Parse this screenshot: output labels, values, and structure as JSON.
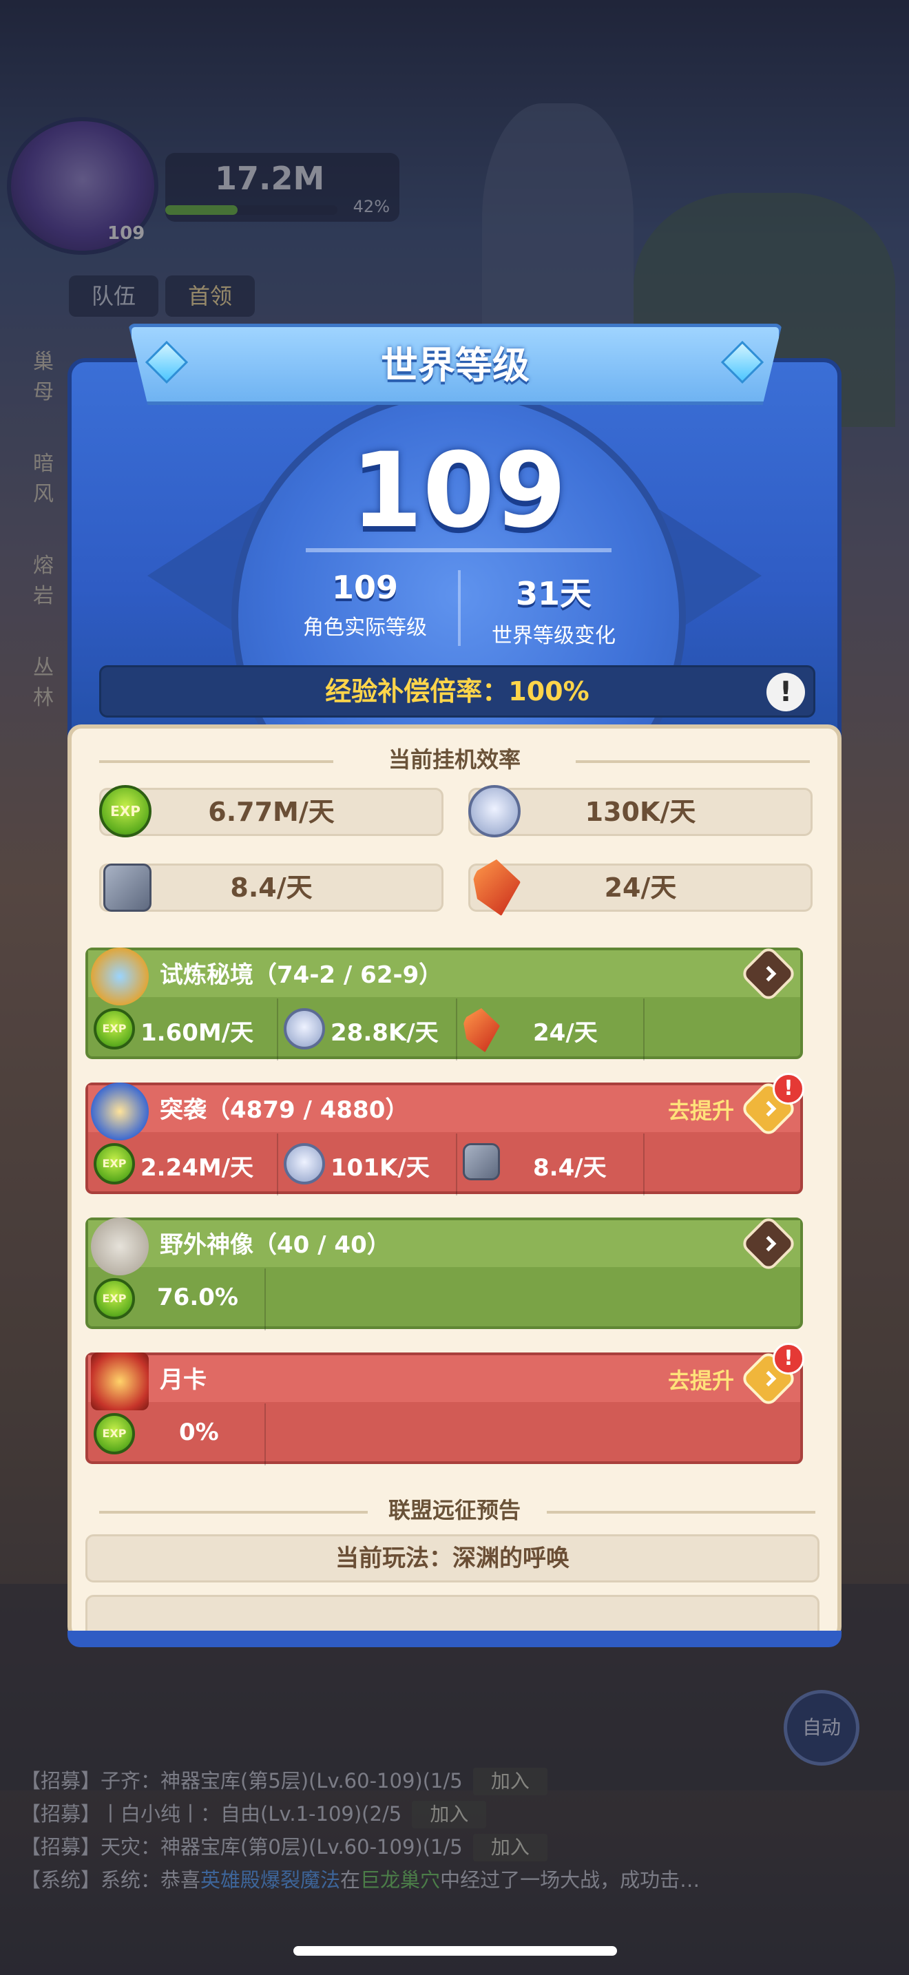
{
  "hud": {
    "player_level": "109",
    "power": "17.2M",
    "power_percent": "42%",
    "power_progress": 0.42,
    "tab_team": "队伍",
    "tab_leader": "首领",
    "side_labels": [
      "巢母",
      "暗风",
      "熔岩",
      "丛林"
    ]
  },
  "modal": {
    "title": "世界等级",
    "world_level": "109",
    "actual_level_value": "109",
    "actual_level_label": "角色实际等级",
    "level_change_value": "31天",
    "level_change_label": "世界等级变化",
    "exp_rate_label": "经验补偿倍率：100%",
    "efficiency_title": "当前挂机效率",
    "efficiency": {
      "exp": "6.77M/天",
      "coin": "130K/天",
      "stone": "8.4/天",
      "crystal": "24/天"
    },
    "cards": [
      {
        "title": "试炼秘境（74-2 / 62-9）",
        "theme": "green",
        "improve": "",
        "exp": "1.60M/天",
        "coin": "28.8K/天",
        "crystal": "24/天"
      },
      {
        "title": "突袭（4879 / 4880）",
        "theme": "red",
        "improve": "去提升",
        "exp": "2.24M/天",
        "coin": "101K/天",
        "stone": "8.4/天"
      },
      {
        "title": "野外神像（40 / 40）",
        "theme": "green",
        "improve": "",
        "exp": "76.0%"
      },
      {
        "title": "月卡",
        "theme": "red",
        "improve": "去提升",
        "exp": "0%"
      }
    ],
    "alliance_title": "联盟远征预告",
    "current_play": "当前玩法：深渊的呼唤",
    "exp_icon_text": "EXP",
    "alert_mark": "!",
    "info_mark": "!"
  },
  "chat": {
    "auto_label": "自动",
    "join_label": "加入",
    "lines": [
      {
        "text": "【招募】子齐：神器宝库(第5层)(Lv.60-109)(1/5",
        "join": true
      },
      {
        "text": "【招募】丨白小纯丨：自由(Lv.1-109)(2/5",
        "join": true
      },
      {
        "text": "【招募】天灾：神器宝库(第0层)(Lv.60-109)(1/5",
        "join": true
      }
    ],
    "system_prefix": "【系统】系统：恭喜",
    "system_name": "英雄殿爆裂魔法",
    "system_mid": "在",
    "system_place": "巨龙巢穴",
    "system_suffix": "中经过了一场大战，成功击…"
  },
  "colors": {
    "modal_blue": "#3b6fd6",
    "exp_rate_yellow": "#ffd54a",
    "card_green": "#7aa346",
    "card_red": "#d25b55",
    "improve_text": "#ffe27a"
  }
}
